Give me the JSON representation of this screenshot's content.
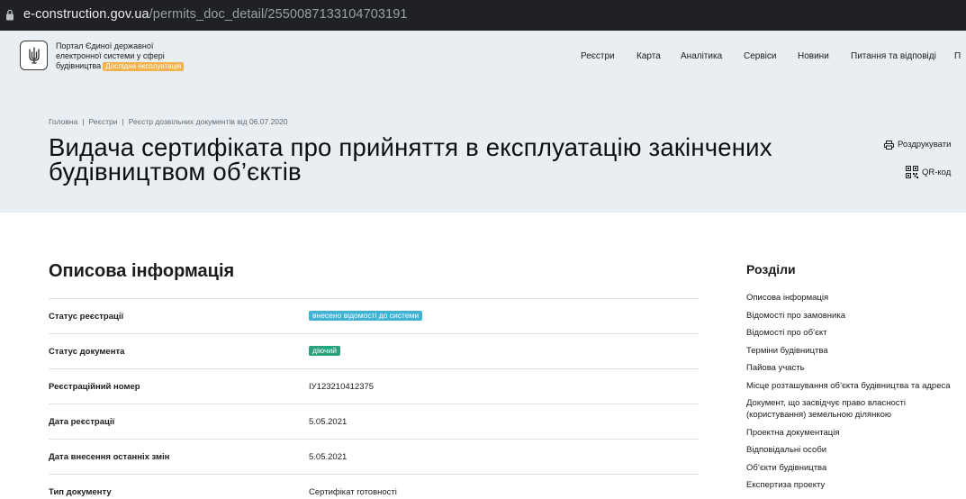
{
  "browser": {
    "url_domain": "e-construction.gov.ua",
    "url_path": "/permits_doc_detail/2550087133104703191"
  },
  "header": {
    "portal_line1": "Портал Єдиної державної",
    "portal_line2": "електронної системи у сфері",
    "portal_line3": "будівництва",
    "test_badge": "Дослідна експлуатація",
    "nav": [
      "Реєстри",
      "Карта",
      "Аналітика",
      "Сервіси",
      "Новини",
      "Питання та відповіді",
      "П"
    ]
  },
  "breadcrumb": [
    "Головна",
    "Реєстри",
    "Реєстр дозвільних документів від 06.07.2020"
  ],
  "title": "Видача сертифіката про прийняття в експлуатацію закінчених будівництвом об’єктів",
  "actions": {
    "print_label": "Роздрукувати",
    "qr_label": "QR-код"
  },
  "info": {
    "section_title": "Описова інформація",
    "rows": [
      {
        "label": "Статус реєстрації",
        "value": "внесено відомості до системи",
        "type": "pill-blue"
      },
      {
        "label": "Статус документа",
        "value": "діючий",
        "type": "pill-green"
      },
      {
        "label": "Реєстраційний номер",
        "value": "ІУ123210412375",
        "type": "text"
      },
      {
        "label": "Дата реєстрації",
        "value": "5.05.2021",
        "type": "text"
      },
      {
        "label": "Дата внесення останніх змін",
        "value": "5.05.2021",
        "type": "text"
      },
      {
        "label": "Тип документу",
        "value": "Сертифікат готовності",
        "type": "text"
      }
    ]
  },
  "sidebar": {
    "title": "Розділи",
    "items": [
      "Описова інформація",
      "Відомості про замовника",
      "Відомості про об’єкт",
      "Терміни будівництва",
      "Пайова участь",
      "Місце розташування об’єкта будівництва та адреса",
      "Документ, що засвідчує право власності (користування) земельною ділянкою",
      "Проектна документація",
      "Відповідальні особи",
      "Об’єкти будівництва",
      "Експертиза проекту"
    ]
  },
  "colors": {
    "header_bg": "#e9eef2",
    "badge_test": "#f4b24b",
    "pill_blue": "#3fb2d6",
    "pill_green": "#2ba27d"
  }
}
